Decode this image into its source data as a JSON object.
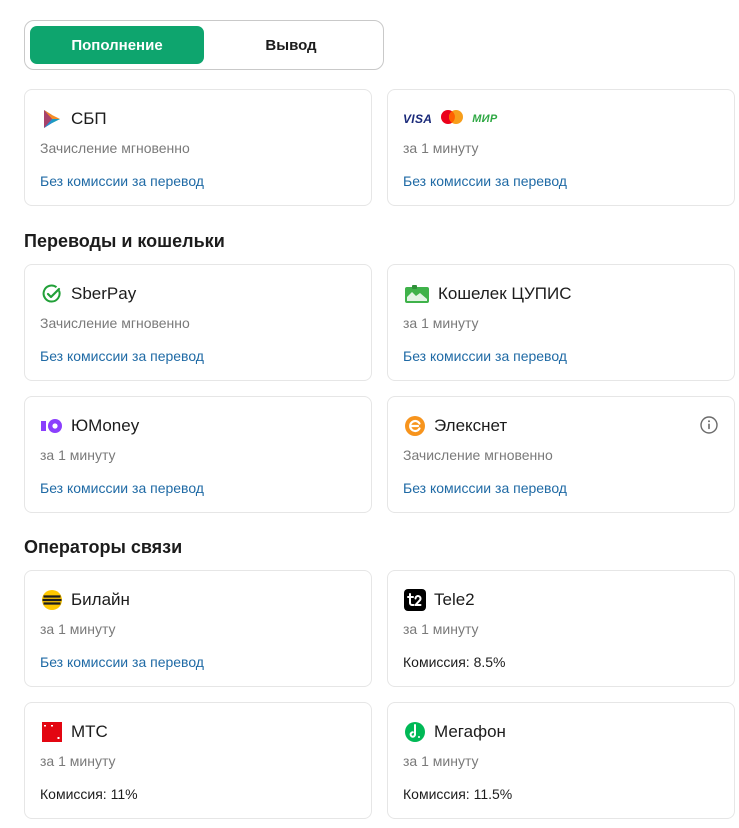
{
  "tabs": {
    "deposit": "Пополнение",
    "withdraw": "Вывод",
    "active": "deposit"
  },
  "top_cards": [
    {
      "title": "СБП",
      "subtitle": "Зачисление мгновенно",
      "fee": "Без комиссии за перевод",
      "icon": "sbp-logo-icon"
    },
    {
      "logos": {
        "visa": "VISA",
        "mir": "МИР"
      },
      "subtitle": "за 1 минуту",
      "fee": "Без комиссии за перевод",
      "icon": "visa-mastercard-mir-logos"
    }
  ],
  "sections": {
    "wallets": {
      "title": "Переводы и кошельки",
      "cards": [
        {
          "title": "SberPay",
          "subtitle": "Зачисление мгновенно",
          "fee": "Без комиссии за перевод",
          "icon": "sberpay-icon"
        },
        {
          "title": "Кошелек ЦУПИС",
          "subtitle": "за 1 минуту",
          "fee": "Без комиссии за перевод",
          "icon": "cupis-wallet-icon"
        },
        {
          "title": "ЮMoney",
          "subtitle": "за 1 минуту",
          "fee": "Без комиссии за перевод",
          "icon": "yoomoney-icon"
        },
        {
          "title": "Элекснет",
          "subtitle": "Зачисление мгновенно",
          "fee": "Без комиссии за перевод",
          "icon": "elecsnet-icon",
          "info_icon": "info-icon"
        }
      ]
    },
    "operators": {
      "title": "Операторы связи",
      "cards": [
        {
          "title": "Билайн",
          "subtitle": "за 1 минуту",
          "fee": "Без комиссии за перевод",
          "icon": "beeline-icon"
        },
        {
          "title": "Tele2",
          "subtitle": "за 1 минуту",
          "fee": "Комиссия: 8.5%",
          "icon": "tele2-icon"
        },
        {
          "title": "МТС",
          "subtitle": "за 1 минуту",
          "fee": "Комиссия: 11%",
          "icon": "mts-icon"
        },
        {
          "title": "Мегафон",
          "subtitle": "за 1 минуту",
          "fee": "Комиссия: 11.5%",
          "icon": "megafon-icon"
        }
      ]
    }
  },
  "colors": {
    "accent": "#0ea56e",
    "link": "#1f6aa5",
    "muted": "#7a7a7a",
    "border": "#e6e6e6"
  }
}
